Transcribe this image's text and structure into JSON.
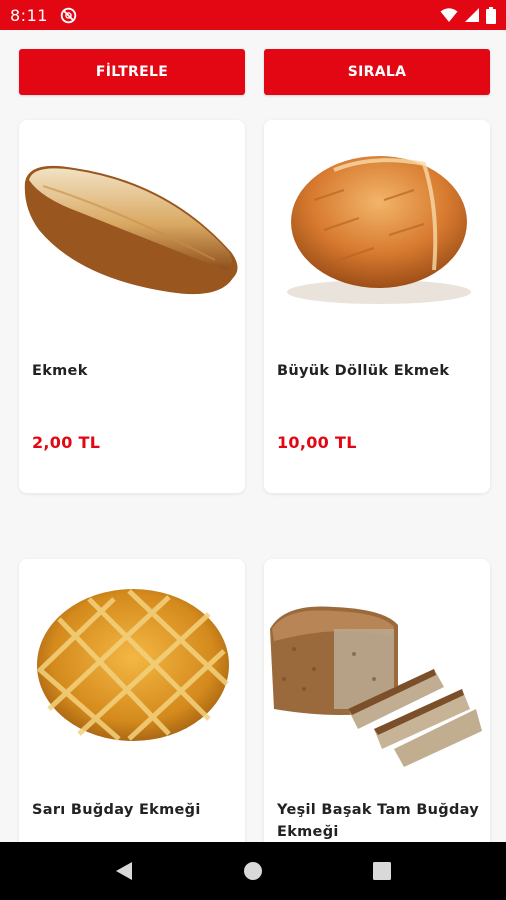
{
  "status_bar": {
    "time": "8:11"
  },
  "toolbar": {
    "filter_label": "FİLTRELE",
    "sort_label": "SIRALA"
  },
  "products": [
    {
      "name": "Ekmek",
      "price": "2,00 TL"
    },
    {
      "name": "Büyük Döllük Ekmek",
      "price": "10,00 TL"
    },
    {
      "name": "Sarı Buğday Ekmeği",
      "price": ""
    },
    {
      "name": "Yeşil Başak Tam Buğday Ekmeği",
      "price": ""
    }
  ],
  "icons": {
    "dnd": "do-not-disturb-icon",
    "wifi": "wifi-icon",
    "signal": "signal-icon",
    "battery": "battery-icon",
    "back": "back-icon",
    "home": "home-icon",
    "recents": "recents-icon"
  },
  "colors": {
    "accent": "#e30613",
    "background": "#f7f7f7",
    "card": "#ffffff",
    "nav": "#000000"
  }
}
